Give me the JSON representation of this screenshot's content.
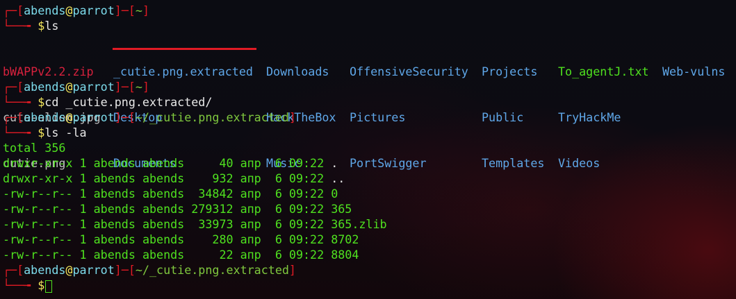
{
  "prompt1": {
    "box_top": "┌─[",
    "user": "abends",
    "at": "@",
    "host": "parrot",
    "sep": "]─[",
    "path": "~",
    "close": "]",
    "box_bottom": "└──╼ ",
    "dollar": "$",
    "command": "ls"
  },
  "ls_output": {
    "col1": [
      "bWAPPv2.2.zip",
      "cute-alien.jpg",
      "cutie.png"
    ],
    "col2": [
      "_cutie.png.extracted",
      "Desktop",
      "Documents"
    ],
    "col3": [
      "Downloads",
      "HackTheBox",
      "Music"
    ],
    "col4": [
      "OffensiveSecurity",
      "Pictures",
      "PortSwigger"
    ],
    "col5": [
      "Projects",
      "Public",
      "Templates"
    ],
    "col6": [
      "To_agentJ.txt",
      "TryHackMe",
      "Videos"
    ],
    "col7": [
      "Web-vulns"
    ]
  },
  "prompt2": {
    "box_top": "┌─[",
    "user": "abends",
    "at": "@",
    "host": "parrot",
    "sep": "]─[",
    "path": "~",
    "close": "]",
    "box_bottom": "└──╼ ",
    "dollar": "$",
    "command": "cd _cutie.png.extracted/"
  },
  "prompt3": {
    "box_top": "┌─[",
    "user": "abends",
    "at": "@",
    "host": "parrot",
    "sep": "]─[",
    "path": "~/_cutie.png.extracted",
    "close": "]",
    "box_bottom": "└──╼ ",
    "dollar": "$",
    "command": "ls -la"
  },
  "listing": {
    "total": "total 356",
    "rows": [
      {
        "perms": "drwxr-xr-x",
        "links": "1",
        "owner": "abends",
        "group": "abends",
        "size": "40",
        "month": "апр",
        "day": "6",
        "time": "09:22",
        "name": "."
      },
      {
        "perms": "drwxr-xr-x",
        "links": "1",
        "owner": "abends",
        "group": "abends",
        "size": "932",
        "month": "апр",
        "day": "6",
        "time": "09:22",
        "name": ".."
      },
      {
        "perms": "-rw-r--r--",
        "links": "1",
        "owner": "abends",
        "group": "abends",
        "size": "34842",
        "month": "апр",
        "day": "6",
        "time": "09:22",
        "name": "0"
      },
      {
        "perms": "-rw-r--r--",
        "links": "1",
        "owner": "abends",
        "group": "abends",
        "size": "279312",
        "month": "апр",
        "day": "6",
        "time": "09:22",
        "name": "365"
      },
      {
        "perms": "-rw-r--r--",
        "links": "1",
        "owner": "abends",
        "group": "abends",
        "size": "33973",
        "month": "апр",
        "day": "6",
        "time": "09:22",
        "name": "365.zlib"
      },
      {
        "perms": "-rw-r--r--",
        "links": "1",
        "owner": "abends",
        "group": "abends",
        "size": "280",
        "month": "апр",
        "day": "6",
        "time": "09:22",
        "name": "8702"
      },
      {
        "perms": "-rw-r--r--",
        "links": "1",
        "owner": "abends",
        "group": "abends",
        "size": "22",
        "month": "апр",
        "day": "6",
        "time": "09:22",
        "name": "8804"
      }
    ]
  },
  "prompt4": {
    "box_top": "┌─[",
    "user": "abends",
    "at": "@",
    "host": "parrot",
    "sep": "]─[",
    "path": "~/_cutie.png.extracted",
    "close": "]",
    "box_bottom": "└──╼ ",
    "dollar": "$",
    "command": ""
  },
  "colors": {
    "prompt_red": "#e01b24",
    "user": "#7ddcec",
    "host": "#7ddcec",
    "dollar": "#f5e85c",
    "output_green": "#4fe11f",
    "dir_blue": "#5fa7e8",
    "archive_red": "#d8213d",
    "highlight_underline": "#e01b24"
  }
}
